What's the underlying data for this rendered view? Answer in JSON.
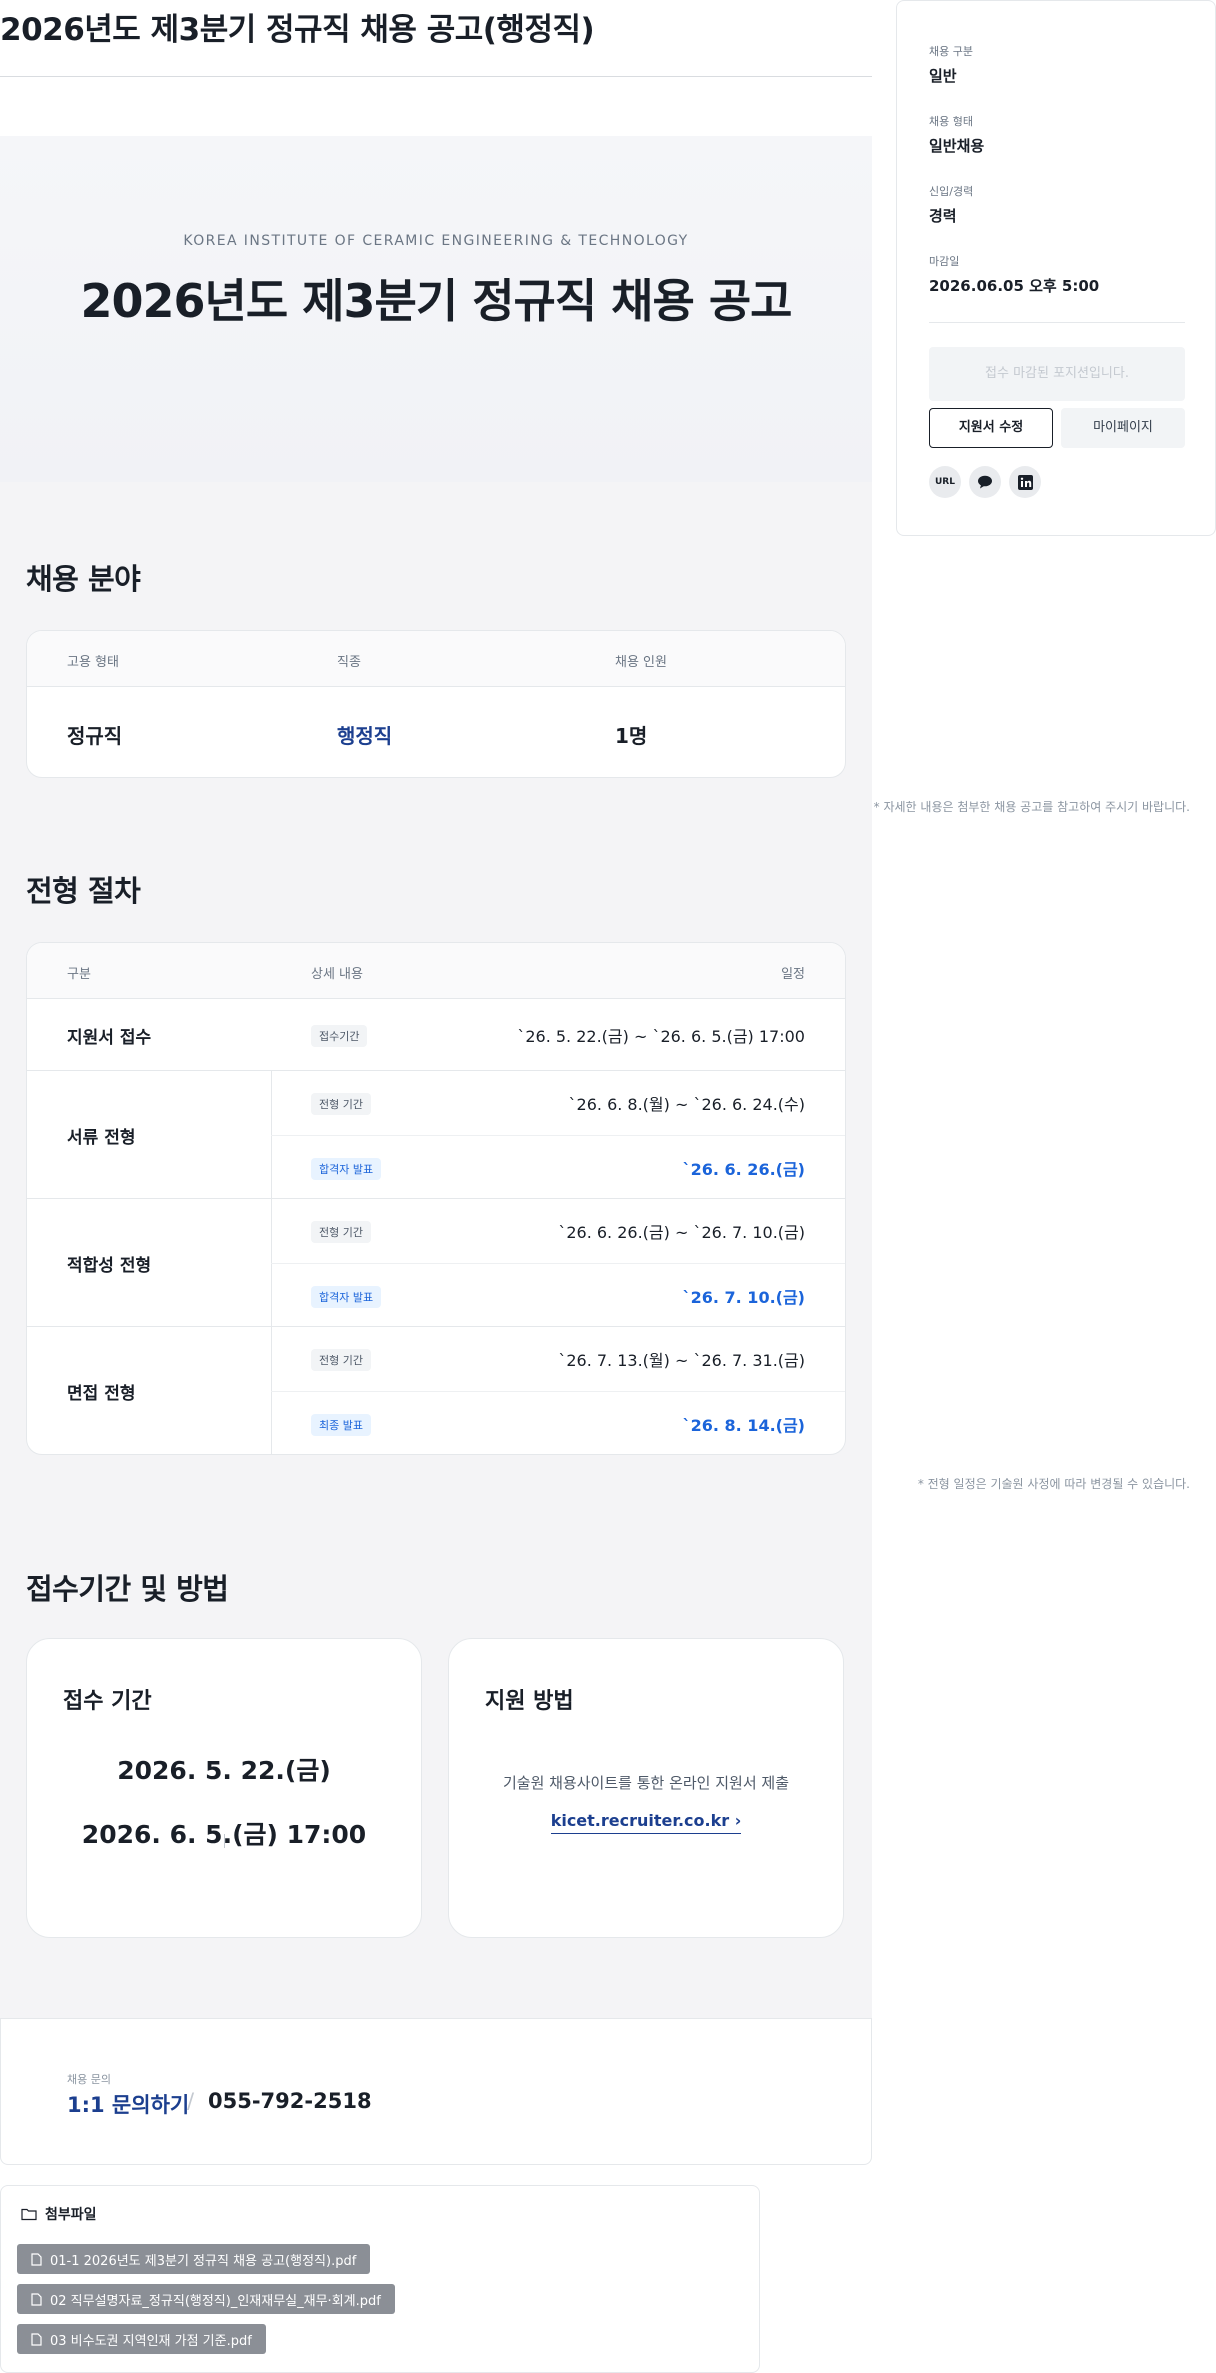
{
  "page_title": "2026년도 제3분기 정규직 채용 공고(행정직)",
  "hero": {
    "org": "KOREA INSTITUTE OF CERAMIC ENGINEERING & TECHNOLOGY",
    "title": "2026년도 제3분기 정규직 채용 공고"
  },
  "recruit_field": {
    "heading": "채용 분야",
    "columns": [
      "고용 형태",
      "직종",
      "채용 인원"
    ],
    "row": [
      "정규직",
      "행정직",
      "1명"
    ],
    "note": "* 자세한 내용은 첨부한 채용 공고를 참고하여 주시기 바랍니다."
  },
  "process": {
    "heading": "전형 절차",
    "columns": [
      "구분",
      "상세 내용",
      "일정"
    ],
    "stages": [
      {
        "name": "지원서 접수",
        "items": [
          {
            "badge": "접수기간",
            "date": "`26. 5. 22.(금) ~ `26. 6. 5.(금) 17:00"
          }
        ]
      },
      {
        "name": "서류 전형",
        "items": [
          {
            "badge": "전형 기간",
            "date": "`26. 6. 8.(월) ~ `26. 6. 24.(수)"
          },
          {
            "badge": "합격자 발표",
            "date": "`26. 6. 26.(금)"
          }
        ]
      },
      {
        "name": "적합성 전형",
        "items": [
          {
            "badge": "전형 기간",
            "date": "`26. 6. 26.(금) ~ `26. 7. 10.(금)"
          },
          {
            "badge": "합격자 발표",
            "date": "`26. 7. 10.(금)"
          }
        ]
      },
      {
        "name": "면접 전형",
        "items": [
          {
            "badge": "전형 기간",
            "date": "`26. 7. 13.(월) ~ `26. 7. 31.(금)"
          },
          {
            "badge": "최종 발표",
            "date": "`26. 8. 14.(금)"
          }
        ]
      }
    ],
    "note": "* 전형 일정은 기술원 사정에 따라 변경될 수 있습니다."
  },
  "period": {
    "heading": "접수기간 및 방법",
    "period_title": "접수 기간",
    "from": "2026. 5. 22.(금)",
    "to": "2026. 6. 5.(금) 17:00",
    "method_title": "지원 방법",
    "method_desc": "기술원 채용사이트를 통한 온라인 지원서 제출",
    "method_link": "kicet.recruiter.co.kr ›"
  },
  "contact": {
    "label": "채용 문의",
    "link": "1:1 문의하기",
    "sep": "/",
    "phone": "055-792-2518"
  },
  "attachments": {
    "heading": "첨부파일",
    "files": [
      "01-1 2026년도 제3분기 정규직 채용 공고(행정직).pdf",
      "02 직무설명자료_정규직(행정직)_인재재무실_재무·회계.pdf",
      "03 비수도권 지역인재 가점 기준.pdf"
    ]
  },
  "sidebar": {
    "fields": [
      {
        "label": "채용 구분",
        "value": "일반"
      },
      {
        "label": "채용 형태",
        "value": "일반채용"
      },
      {
        "label": "신입/경력",
        "value": "경력"
      },
      {
        "label": "마감일",
        "value": "2026.06.05 오후 5:00"
      }
    ],
    "closed_text": "접수 마감된 포지션입니다.",
    "edit_button": "지원서 수정",
    "mypage_button": "마이페이지",
    "share_url": "URL"
  },
  "icons": {
    "share": [
      "link-icon",
      "kakao-icon",
      "linkedin-icon"
    ],
    "folder": "folder-icon",
    "file": "file-icon"
  }
}
